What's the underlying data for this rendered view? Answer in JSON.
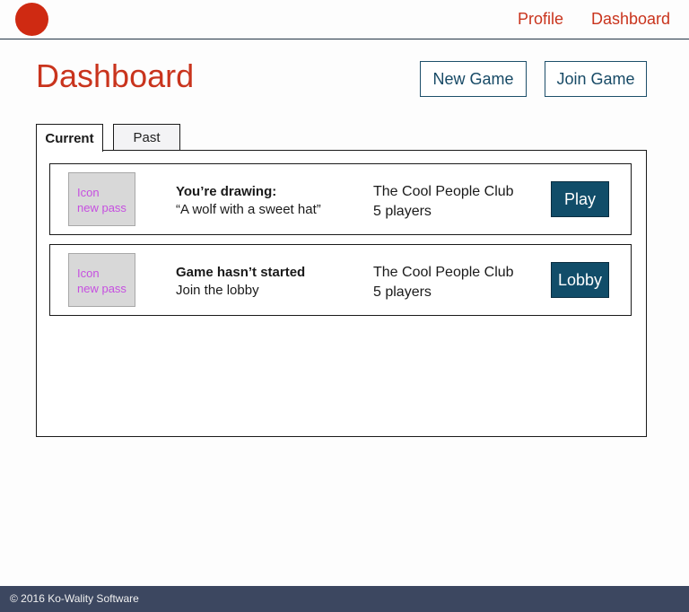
{
  "header": {
    "nav": [
      {
        "label": "Profile"
      },
      {
        "label": "Dashboard"
      }
    ]
  },
  "page": {
    "title": "Dashboard",
    "new_game_label": "New Game",
    "join_game_label": "Join Game"
  },
  "tabs": [
    {
      "label": "Current",
      "active": true
    },
    {
      "label": "Past",
      "active": false
    }
  ],
  "games": [
    {
      "icon_text_1": "Icon",
      "icon_text_2": "new pass",
      "status_title": "You’re drawing:",
      "status_sub": "“A wolf with a sweet hat”",
      "club": "The Cool People Club",
      "players": "5 players",
      "action": "Play"
    },
    {
      "icon_text_1": "Icon",
      "icon_text_2": "new pass",
      "status_title": "Game hasn’t started",
      "status_sub": "Join the lobby",
      "club": "The Cool People Club",
      "players": "5 players",
      "action": "Lobby"
    }
  ],
  "footer": {
    "copyright": "© 2016 Ko-Wality Software"
  },
  "colors": {
    "accent": "#c9341d",
    "logo": "#cf2a12",
    "primary_button": "#114d69",
    "footer_bg": "#3c4760",
    "icon_placeholder_text": "#c64fe0"
  }
}
